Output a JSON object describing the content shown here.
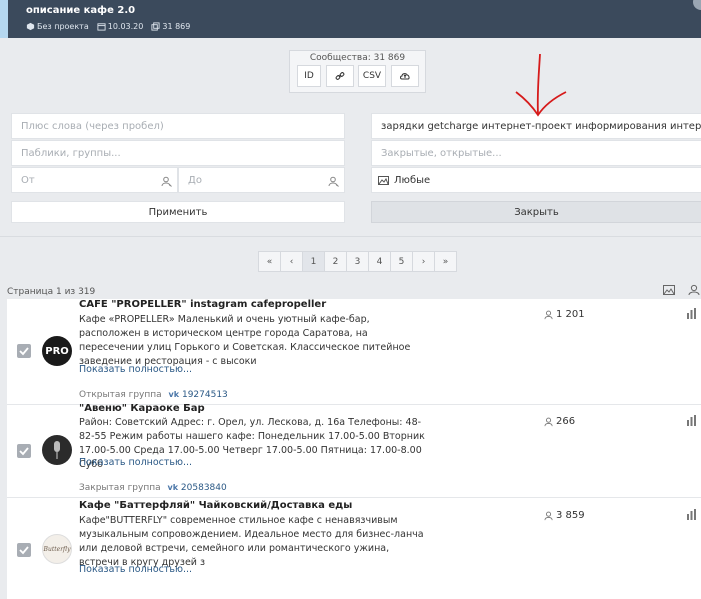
{
  "header": {
    "title": "описание кафе 2.0",
    "project": "Без проекта",
    "date": "10.03.20",
    "count": "31 869"
  },
  "communities": {
    "label": "Сообщества: 31 869",
    "id_label": "ID",
    "csv_label": "CSV"
  },
  "filters": {
    "plus_words_placeholder": "Плюс слова (через пробел)",
    "publics_placeholder": "Паблики, группы...",
    "from_placeholder": "От",
    "to_placeholder": "До",
    "keywords_value": "зарядки getcharge интернет-проект информирования интерне",
    "closed_placeholder": "Закрытые, открытые...",
    "type_value": "Любые",
    "apply_label": "Применить",
    "close_label": "Закрыть"
  },
  "pagination": {
    "first": "«",
    "prev": "‹",
    "pages": [
      "1",
      "2",
      "3",
      "4",
      "5"
    ],
    "next": "›",
    "last": "»",
    "active": 1,
    "info": "Страница 1 из 319"
  },
  "results": [
    {
      "title": "CAFE \"PROPELLER\" instagram cafepropeller",
      "description": "Кафе «PROPELLER» Маленький и очень уютный кафе-бар, расположен в историческом центре города Саратова, на пересечении улиц Горького и Советская. Классическое питейное заведение и ресторация - с высоки",
      "more": "Показать полностью...",
      "type": "Открытая группа",
      "vk_id": "19274513",
      "members": "1 201"
    },
    {
      "title": "\"Авеню\" Караоке Бар",
      "description": "Район: Советский Адрес: г. Орел, ул. Лескова, д. 16а Телефоны: 48-82-55 Режим работы нашего кафе: Понедельник 17.00-5.00 Вторник 17.00-5.00 Среда 17.00-5.00 Четверг 17.00-5.00 Пятница: 17.00-8.00 Субб",
      "more": "Показать полностью...",
      "type": "Закрытая группа",
      "vk_id": "20583840",
      "members": "266"
    },
    {
      "title": "Кафе \"Баттерфляй\" Чайковский/Доставка еды",
      "description": "Кафе\"BUTTERFLY\" современное стильное кафе с ненавязчивым музыкальным сопровождением. Идеальное место для бизнес-ланча или деловой встречи, семейного или романтического ужина, встречи в кругу друзей з",
      "more": "Показать полностью...",
      "members": "3 859"
    }
  ],
  "avatars": {
    "r0": "PRO",
    "r2": "Butterfly"
  },
  "colors": {
    "topbar": "#3b4a5c",
    "link": "#2a5885",
    "annotation_arrow": "#d61a1a"
  }
}
